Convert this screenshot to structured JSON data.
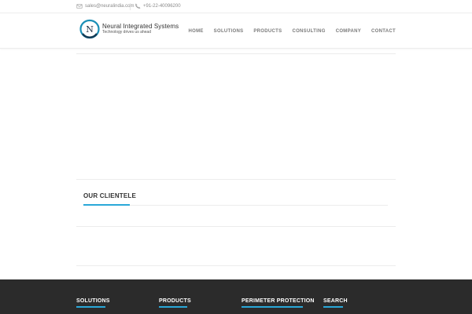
{
  "topbar": {
    "email": "sales@neuralindia.com",
    "phone": "+91-22-40096200",
    "email_icon": "envelope-icon",
    "phone_icon": "phone-icon"
  },
  "header": {
    "logo_letter": "N",
    "logo_name": "Neural Integrated Systems",
    "logo_tagline": "Technology drives us ahead"
  },
  "nav": {
    "items": [
      "HOME",
      "SOLUTIONS",
      "PRODUCTS",
      "CONSULTING",
      "COMPANY",
      "CONTACT"
    ]
  },
  "main": {
    "clientele_title": "OUR CLIENTELE"
  },
  "footer": {
    "columns": [
      "SOLUTIONS",
      "PRODUCTS",
      "PERIMETER PROTECTION",
      "SEARCH"
    ]
  },
  "colors": {
    "accent": "#2aa8d8",
    "footer_bg": "#2b2b2b",
    "text": "#333333"
  }
}
